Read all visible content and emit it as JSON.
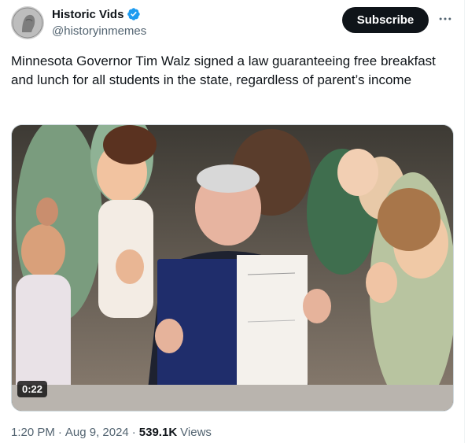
{
  "author": {
    "display_name": "Historic Vids",
    "handle": "@historyinmemes",
    "verified": true
  },
  "actions": {
    "subscribe_label": "Subscribe",
    "more_icon": "more-horizontal-icon"
  },
  "tweet": {
    "text": "Minnesota Governor Tim Walz signed a law guaranteeing free breakfast and lunch for all students in the state, regardless of parent’s income"
  },
  "media": {
    "duration": "0:22"
  },
  "meta": {
    "time": "1:20 PM",
    "sep1": "·",
    "date": "Aug 9, 2024",
    "sep2": "·",
    "views_count": "539.1K",
    "views_label": "Views"
  },
  "colors": {
    "text_primary": "#0f1419",
    "text_secondary": "#536471",
    "verified_blue": "#1d9bf0",
    "button_dark": "#0f1419"
  }
}
